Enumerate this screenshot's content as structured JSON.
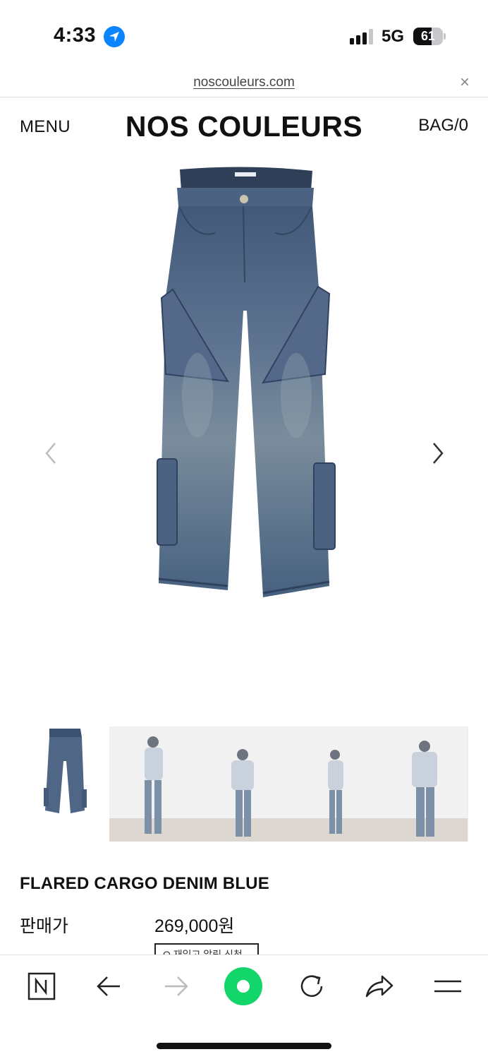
{
  "status_bar": {
    "time": "4:33",
    "network": "5G",
    "battery_percent": "61",
    "battery_level": 0.61,
    "icons": [
      "location-arrow-icon",
      "signal-icon",
      "battery-icon"
    ]
  },
  "url_bar": {
    "url": "noscouleurs.com",
    "close_label": "×"
  },
  "header": {
    "menu_label": "MENU",
    "logo": "NOS COULEURS",
    "bag_label": "BAG/0"
  },
  "product": {
    "name": "FLARED CARGO DENIM BLUE",
    "price_label": "판매가",
    "price": "269,000원",
    "restock_label": "Q 재입고 알림 신청",
    "image_icon": "jeans-product-image",
    "denim_color": "#4a6383"
  },
  "gallery": {
    "prev_icon": "chevron-left-icon",
    "next_icon": "chevron-right-icon",
    "thumbnails": [
      "thumb-product",
      "thumb-look-1",
      "thumb-look-2",
      "thumb-look-3",
      "thumb-look-4"
    ]
  },
  "toolbar": {
    "items": [
      "naver-n-icon",
      "back-arrow-icon",
      "forward-arrow-icon",
      "home-dot-icon",
      "reload-icon",
      "share-icon",
      "menu-lines-icon"
    ],
    "accent": "#13d66b"
  }
}
